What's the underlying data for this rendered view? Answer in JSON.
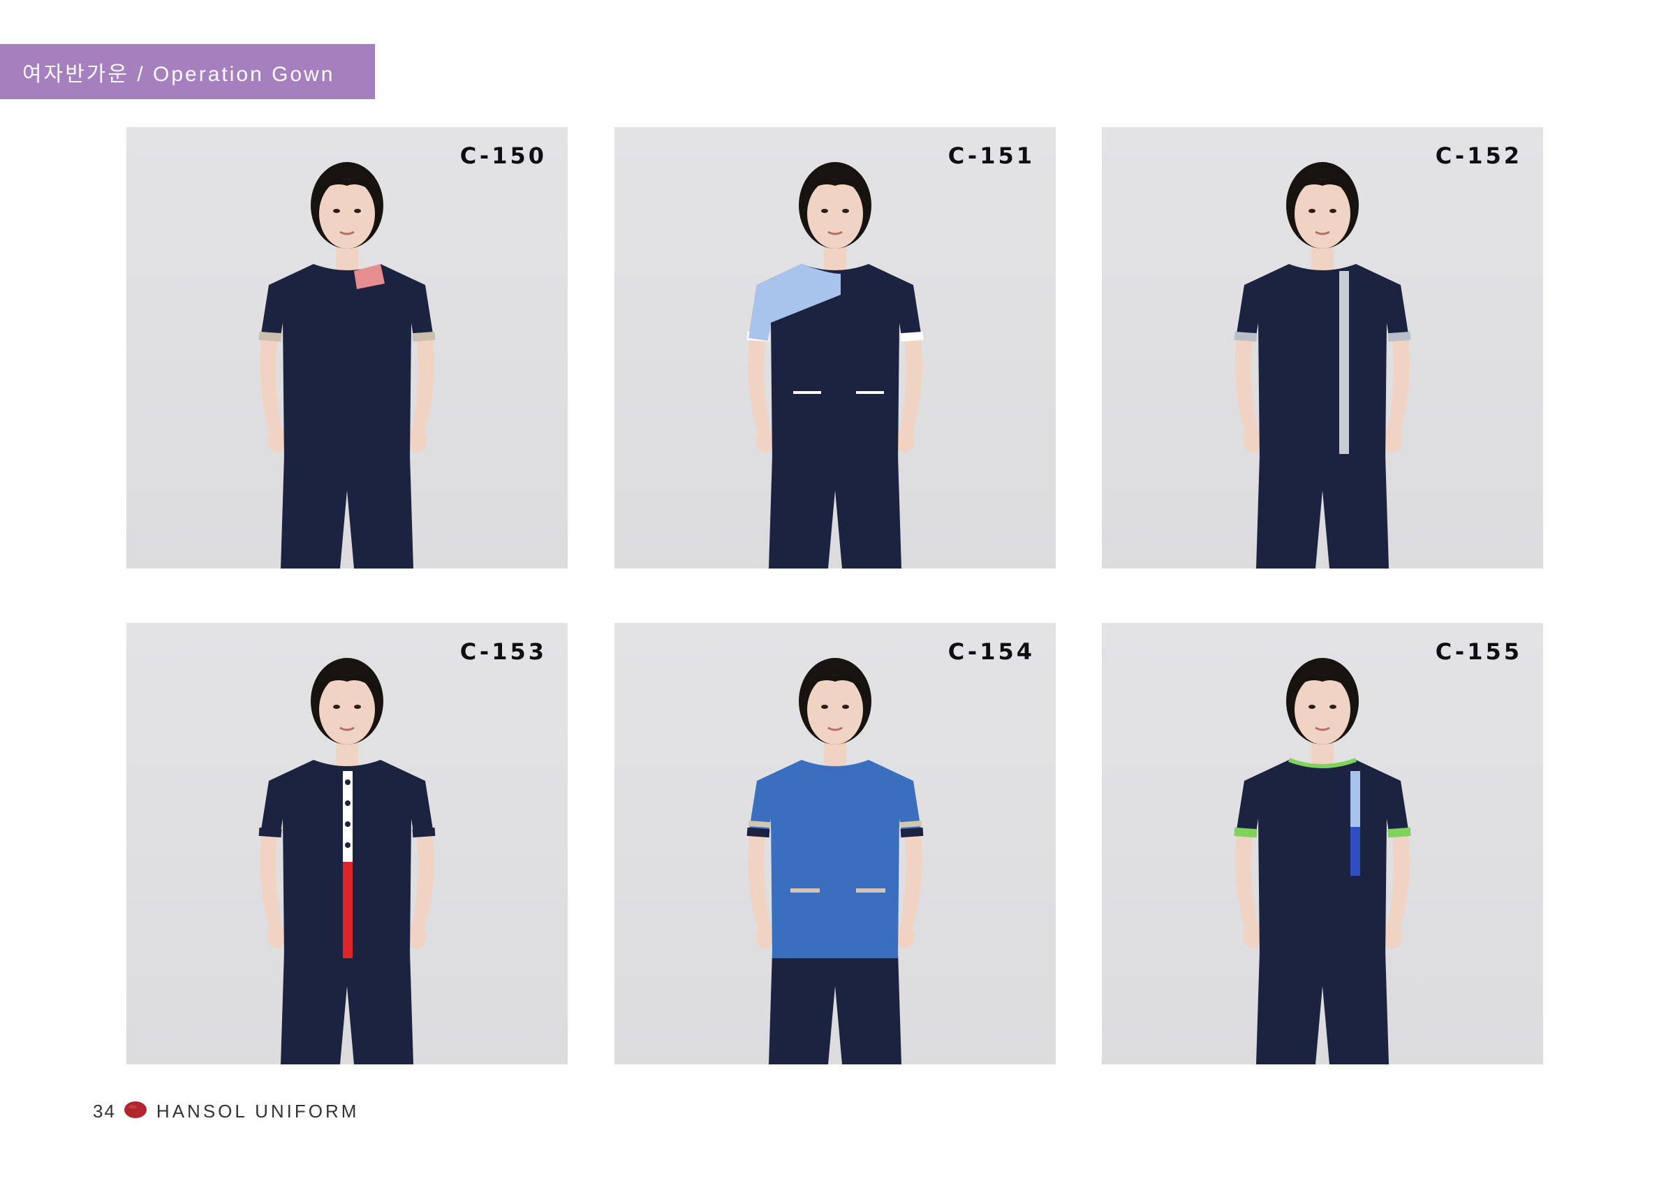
{
  "header": {
    "title": "여자반가운 / Operation Gown",
    "band_color": "#a67fbf"
  },
  "products": [
    {
      "code": "C-150",
      "top_color": "#1c2340",
      "accent_color": "#e58d8f",
      "accent_icon": "collar-accent-pink",
      "cuff_color": "#cdbfae"
    },
    {
      "code": "C-151",
      "top_color": "#1c2340",
      "accent_color": "#a9c4ec",
      "accent_icon": "shoulder-panel-light-blue",
      "cuff_color": "#ffffff"
    },
    {
      "code": "C-152",
      "top_color": "#1c2340",
      "accent_color": "#c8ccd4",
      "accent_icon": "placket-stripe-grey",
      "cuff_color": "#b9bfca"
    },
    {
      "code": "C-153",
      "top_color": "#1c2340",
      "accent_color": "#e0252a",
      "accent_icon": "placket-stripe-red",
      "cuff_color": "#1c2340"
    },
    {
      "code": "C-154",
      "top_color": "#3a6fc0",
      "accent_color": "#d4c7b2",
      "accent_icon": "sleeve-band-beige",
      "cuff_color": "#1c2340"
    },
    {
      "code": "C-155",
      "top_color": "#1c2340",
      "accent_color": "#7fd35b",
      "accent_icon": "sleeve-band-green",
      "cuff_color": "#2f4fc0"
    }
  ],
  "footer": {
    "page_number": "34",
    "brand": "HANSOL UNIFORM",
    "logo_color": "#b0262c"
  }
}
